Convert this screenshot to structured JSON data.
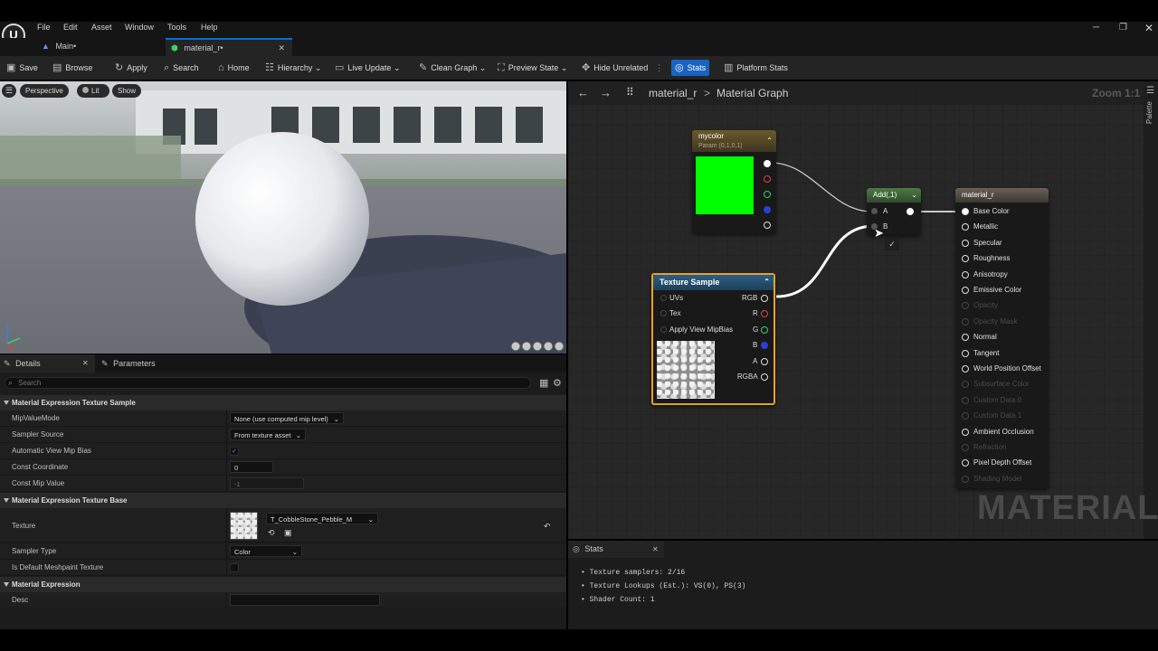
{
  "menu": [
    "File",
    "Edit",
    "Asset",
    "Window",
    "Tools",
    "Help"
  ],
  "tabs": [
    {
      "label": "Main•"
    },
    {
      "label": "material_r•"
    }
  ],
  "toolbar": {
    "save": "Save",
    "browse": "Browse",
    "apply": "Apply",
    "search": "Search",
    "home": "Home",
    "hierarchy": "Hierarchy",
    "live_update": "Live Update",
    "clean_graph": "Clean Graph",
    "preview_state": "Preview State",
    "hide_unrelated": "Hide Unrelated",
    "stats": "Stats",
    "platform_stats": "Platform Stats"
  },
  "viewport": {
    "perspective": "Perspective",
    "lit": "Lit",
    "show": "Show"
  },
  "details": {
    "tab_details": "Details",
    "tab_parameters": "Parameters",
    "search_placeholder": "Search",
    "cat1": "Material Expression Texture Sample",
    "rows1": [
      {
        "label": "MipValueMode",
        "value": "None (use computed mip level)"
      },
      {
        "label": "Sampler Source",
        "value": "From texture asset"
      },
      {
        "label": "Automatic View Mip Bias",
        "value": "✓"
      },
      {
        "label": "Const Coordinate",
        "value": "0"
      },
      {
        "label": "Const Mip Value",
        "value": "-1"
      }
    ],
    "cat2": "Material Expression Texture Base",
    "texture_label": "Texture",
    "texture_value": "T_CobbleStone_Pebble_M",
    "sampler_type_label": "Sampler Type",
    "sampler_type_value": "Color",
    "meshpaint_label": "Is Default Meshpaint Texture",
    "cat3": "Material Expression",
    "desc_label": "Desc"
  },
  "graph": {
    "breadcrumb_root": "material_r",
    "breadcrumb_sep": ">",
    "breadcrumb_leaf": "Material Graph",
    "zoom": "Zoom 1:1",
    "palette": "Palette",
    "watermark": "MATERIAL",
    "mycolor": {
      "title": "mycolor",
      "subtitle": "Param (0,1,0,1)",
      "swatch": "#00ff00"
    },
    "add": {
      "title": "Add(,1)",
      "pin_a": "A",
      "pin_b": "B"
    },
    "texture_sample": {
      "title": "Texture Sample",
      "inputs": [
        "UVs",
        "Tex",
        "Apply View MipBias"
      ],
      "outputs": [
        "RGB",
        "R",
        "G",
        "B",
        "A",
        "RGBA"
      ]
    },
    "material": {
      "title": "material_r",
      "pins": [
        {
          "label": "Base Color",
          "enabled": true
        },
        {
          "label": "Metallic",
          "enabled": true
        },
        {
          "label": "Specular",
          "enabled": true
        },
        {
          "label": "Roughness",
          "enabled": true
        },
        {
          "label": "Anisotropy",
          "enabled": true
        },
        {
          "label": "Emissive Color",
          "enabled": true
        },
        {
          "label": "Opacity",
          "enabled": false
        },
        {
          "label": "Opacity Mask",
          "enabled": false
        },
        {
          "label": "Normal",
          "enabled": true
        },
        {
          "label": "Tangent",
          "enabled": true
        },
        {
          "label": "World Position Offset",
          "enabled": true
        },
        {
          "label": "Subsurface Color",
          "enabled": false
        },
        {
          "label": "Custom Data 0",
          "enabled": false
        },
        {
          "label": "Custom Data 1",
          "enabled": false
        },
        {
          "label": "Ambient Occlusion",
          "enabled": true
        },
        {
          "label": "Refraction",
          "enabled": false
        },
        {
          "label": "Pixel Depth Offset",
          "enabled": true
        },
        {
          "label": "Shading Model",
          "enabled": false
        }
      ]
    }
  },
  "stats": {
    "title": "Stats",
    "lines": [
      "Texture samplers: 2/16",
      "Texture Lookups (Est.): VS(0), PS(3)",
      "Shader Count: 1"
    ]
  }
}
